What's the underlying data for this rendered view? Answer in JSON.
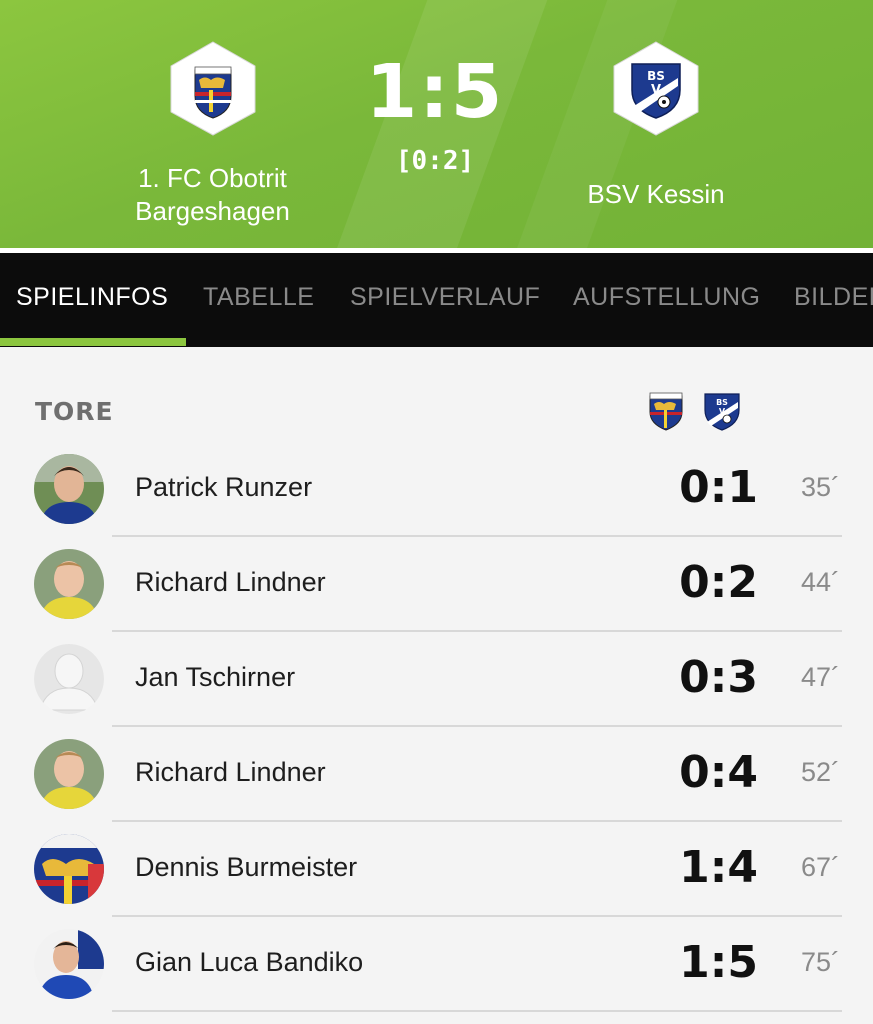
{
  "match": {
    "home_team": "1. FC Obotrit Bargeshagen",
    "home_team_line1": "1. FC Obotrit",
    "home_team_line2": "Bargeshagen",
    "away_team": "BSV Kessin",
    "score": "1:5",
    "halftime": "[0:2]",
    "home_crest_icon": "obotrit-crest-icon",
    "away_crest_icon": "bsv-crest-icon"
  },
  "tabs": [
    {
      "label": "SPIELINFOS",
      "active": true
    },
    {
      "label": "TABELLE",
      "active": false
    },
    {
      "label": "SPIELVERLAUF",
      "active": false
    },
    {
      "label": "AUFSTELLUNG",
      "active": false
    },
    {
      "label": "BILDER",
      "active": false
    }
  ],
  "goals_section": {
    "title": "TORE",
    "goals": [
      {
        "player": "Patrick Runzer",
        "score": "0:1",
        "minute": "35´"
      },
      {
        "player": "Richard Lindner",
        "score": "0:2",
        "minute": "44´"
      },
      {
        "player": "Jan Tschirner",
        "score": "0:3",
        "minute": "47´"
      },
      {
        "player": "Richard Lindner",
        "score": "0:4",
        "minute": "52´"
      },
      {
        "player": "Dennis Burmeister",
        "score": "1:4",
        "minute": "67´"
      },
      {
        "player": "Gian Luca Bandiko",
        "score": "1:5",
        "minute": "75´"
      }
    ]
  },
  "colors": {
    "header_green": "#8cc63f",
    "tab_bg": "#0c0c0c",
    "tab_accent": "#8cc63f",
    "away_blue": "#1d3a8f"
  }
}
